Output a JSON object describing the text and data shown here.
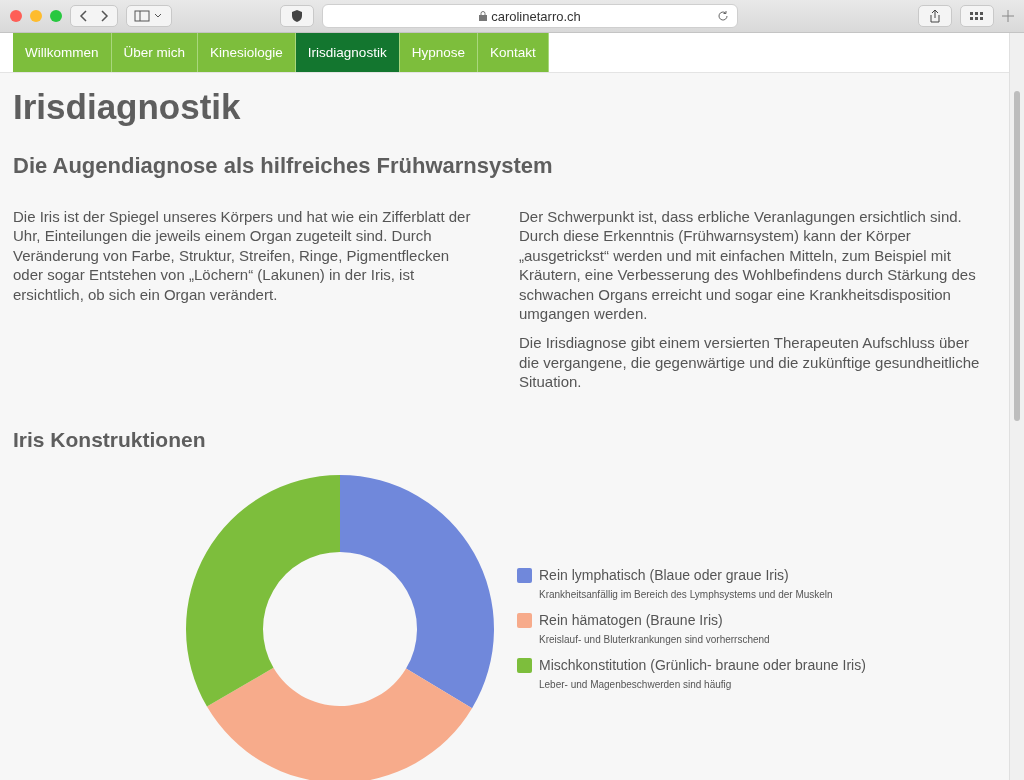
{
  "browser": {
    "url": "carolinetarro.ch"
  },
  "nav": [
    {
      "label": "Willkommen",
      "selected": false
    },
    {
      "label": "Über mich",
      "selected": false
    },
    {
      "label": "Kinesiologie",
      "selected": false
    },
    {
      "label": "Irisdiagnostik",
      "selected": true
    },
    {
      "label": "Hypnose",
      "selected": false
    },
    {
      "label": "Kontakt",
      "selected": false
    }
  ],
  "title": "Irisdiagnostik",
  "subtitle": "Die Augendiagnose als hilfreiches Frühwarnsystem",
  "left_paragraphs": [
    "Die Iris ist der Spiegel unseres Körpers und hat wie ein Zifferblatt der Uhr, Einteilungen die jeweils einem Organ zugeteilt sind. Durch Veränderung von Farbe, Struktur, Streifen, Ringe, Pigmentflecken oder sogar Entstehen von „Löchern“ (Lakunen) in der Iris, ist ersichtlich, ob sich ein Organ verändert."
  ],
  "right_paragraphs": [
    "Der Schwerpunkt ist, dass erbliche Veranlagungen ersichtlich sind. Durch diese Erkenntnis (Frühwarnsystem) kann der Körper „ausgetrickst“ werden und mit einfachen Mitteln, zum Beispiel mit Kräutern, eine Verbesserung des Wohlbefindens durch Stärkung des schwachen Organs erreicht und sogar eine Krankheitsdisposition umgangen werden.",
    "Die Irisdiagnose gibt einem versierten Therapeuten Aufschluss über die vergangene, die gegenwärtige und die zukünftige gesundheitliche Situation."
  ],
  "section_title": "Iris Konstruktionen",
  "legend": [
    {
      "label": "Rein lymphatisch (Blaue oder graue Iris)",
      "description": "Krankheitsanfällig im Bereich des Lymphsystems und der Muskeln",
      "color": "#7088db"
    },
    {
      "label": "Rein hämatogen (Braune Iris)",
      "description": "Kreislauf- und Bluterkrankungen sind vorherrschend",
      "color": "#f7ab8b"
    },
    {
      "label": "Mischkonstitution (Grünlich- braune oder braune Iris)",
      "description": "Leber- und Magenbeschwerden sind häufig",
      "color": "#7dbe3c"
    }
  ]
}
